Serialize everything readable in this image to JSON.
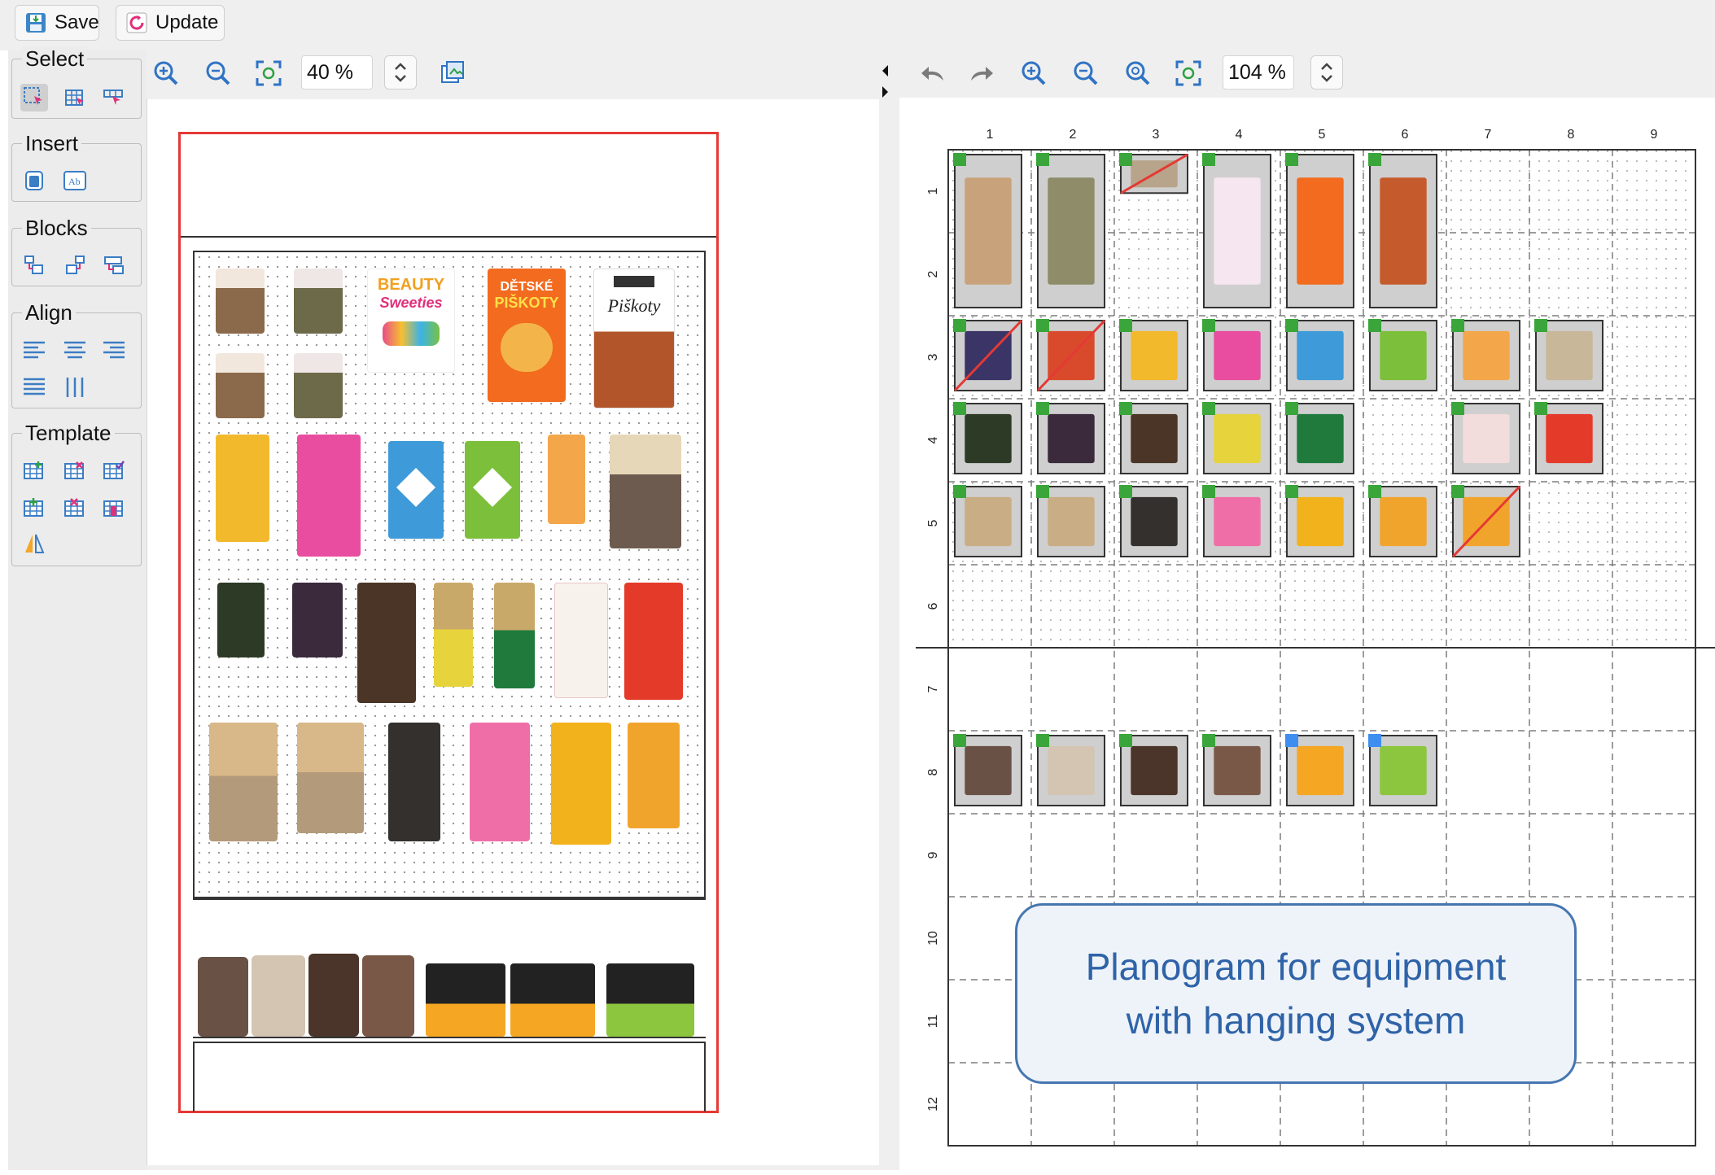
{
  "toolbar": {
    "save_label": "Save",
    "update_label": "Update"
  },
  "sidebar": {
    "groups": [
      {
        "title": "Select"
      },
      {
        "title": "Insert"
      },
      {
        "title": "Blocks"
      },
      {
        "title": "Align"
      },
      {
        "title": "Template"
      }
    ]
  },
  "left_view": {
    "zoom": "40 %"
  },
  "right_view": {
    "zoom": "104 %",
    "columns": [
      "1",
      "2",
      "3",
      "4",
      "5",
      "6",
      "7",
      "8",
      "9"
    ],
    "rows": [
      "1",
      "2",
      "3",
      "4",
      "5",
      "6",
      "7",
      "8",
      "9",
      "10",
      "11",
      "12"
    ]
  },
  "products": {
    "beauty_sweeties": {
      "line1": "BEAUTY",
      "line2": "Sweeties"
    },
    "detske_piskoty": {
      "line1": "DĚTSKÉ",
      "line2": "PIŠKOTY"
    },
    "piskoty": {
      "line1": "Piškoty"
    }
  },
  "callout": {
    "line1": "Planogram for equipment",
    "line2": "with hanging system"
  },
  "colors": {
    "marker_green": "#3aa53a",
    "marker_blue": "#3e8ef0",
    "frame_red": "#e53935",
    "callout_border": "#4676b0",
    "callout_text": "#2f63a8"
  }
}
